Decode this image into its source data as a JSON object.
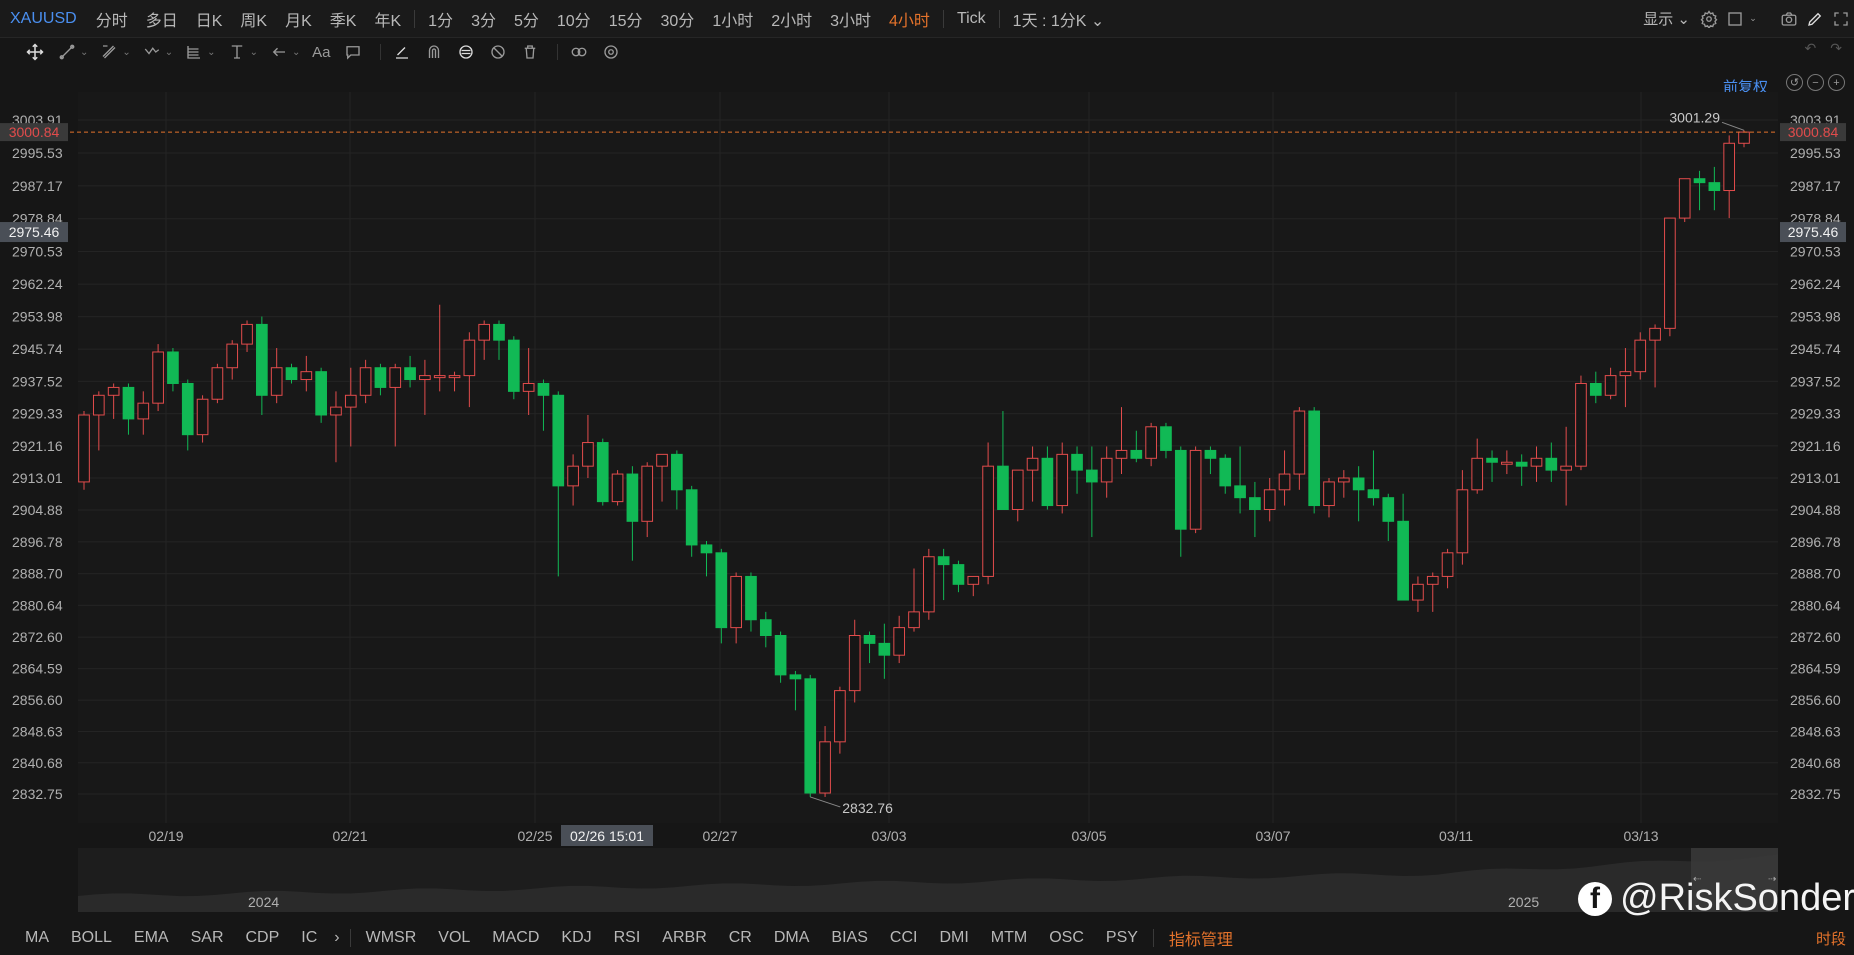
{
  "topbar": {
    "symbol": "XAUUSD",
    "timeframes": [
      "分时",
      "多日",
      "日K",
      "周K",
      "月K",
      "季K",
      "年K",
      "1分",
      "3分",
      "5分",
      "10分",
      "15分",
      "30分",
      "1小时",
      "2小时",
      "3小时",
      "4小时",
      "Tick"
    ],
    "active_timeframe": "4小时",
    "period_select": "1天 : 1分K",
    "display_label": "显示"
  },
  "adjust_label": "前复权",
  "bottombar": {
    "indicators_a": [
      "MA",
      "BOLL",
      "EMA",
      "SAR",
      "CDP",
      "IC"
    ],
    "indicators_b": [
      "WMSR",
      "VOL",
      "MACD",
      "KDJ",
      "RSI",
      "ARBR",
      "CR",
      "DMA",
      "BIAS",
      "CCI",
      "DMI",
      "MTM",
      "OSC",
      "PSY"
    ],
    "manage_label": "指标管理",
    "right_label": "时段"
  },
  "watermark": "@RiskSonder",
  "navigator": {
    "year_left": "2024",
    "year_right": "2025"
  },
  "colors": {
    "up": "#e24c4c",
    "down": "#11b955",
    "accent": "#e3722b",
    "link": "#4a8ff0"
  },
  "chart_data": {
    "type": "candlestick",
    "y_ticks": [
      "3003.91",
      "2995.53",
      "2987.17",
      "2978.84",
      "2970.53",
      "2962.24",
      "2953.98",
      "2945.74",
      "2937.52",
      "2929.33",
      "2921.16",
      "2913.01",
      "2904.88",
      "2896.78",
      "2888.70",
      "2880.64",
      "2872.60",
      "2864.59",
      "2856.60",
      "2848.63",
      "2840.68",
      "2832.75"
    ],
    "x_labels": [
      "02/19",
      "02/21",
      "02/25",
      "02/27",
      "03/03",
      "03/05",
      "03/07",
      "03/11",
      "03/13"
    ],
    "crosshair_x_label": "02/26 15:01",
    "current_price": "3000.84",
    "crosshair_price": "2975.46",
    "max_label": "3001.29",
    "min_label": "2832.76",
    "ohlc": [
      [
        2912,
        2930,
        2910,
        2929
      ],
      [
        2929,
        2935,
        2920,
        2934
      ],
      [
        2934,
        2937,
        2928,
        2936
      ],
      [
        2936,
        2937,
        2924,
        2928
      ],
      [
        2928,
        2935,
        2924,
        2932
      ],
      [
        2932,
        2947,
        2930,
        2945
      ],
      [
        2945,
        2946,
        2935,
        2937
      ],
      [
        2937,
        2938,
        2920,
        2924
      ],
      [
        2924,
        2934,
        2922,
        2933
      ],
      [
        2933,
        2942,
        2932,
        2941
      ],
      [
        2941,
        2948,
        2938,
        2947
      ],
      [
        2947,
        2953,
        2945,
        2952
      ],
      [
        2952,
        2954,
        2929,
        2934
      ],
      [
        2934,
        2946,
        2932,
        2941
      ],
      [
        2941,
        2942,
        2937,
        2938
      ],
      [
        2938,
        2944,
        2935,
        2940
      ],
      [
        2940,
        2941,
        2927,
        2929
      ],
      [
        2929,
        2935,
        2917,
        2931
      ],
      [
        2931,
        2941,
        2921,
        2934
      ],
      [
        2934,
        2943,
        2932,
        2941
      ],
      [
        2941,
        2942,
        2934,
        2936
      ],
      [
        2936,
        2942,
        2921,
        2941
      ],
      [
        2941,
        2944,
        2936,
        2938
      ],
      [
        2938,
        2943,
        2929,
        2939
      ],
      [
        2939,
        2957,
        2935,
        2939
      ],
      [
        2939,
        2940,
        2935,
        2939
      ],
      [
        2939,
        2950,
        2931,
        2948
      ],
      [
        2948,
        2953,
        2943,
        2952
      ],
      [
        2952,
        2953,
        2943,
        2948
      ],
      [
        2948,
        2949,
        2933,
        2935
      ],
      [
        2935,
        2946,
        2929,
        2937
      ],
      [
        2937,
        2938,
        2925,
        2934
      ],
      [
        2934,
        2935,
        2888,
        2911
      ],
      [
        2911,
        2919,
        2906,
        2916
      ],
      [
        2916,
        2929,
        2913,
        2922
      ],
      [
        2922,
        2923,
        2906,
        2907
      ],
      [
        2907,
        2915,
        2906,
        2914
      ],
      [
        2914,
        2916,
        2892,
        2902
      ],
      [
        2902,
        2917,
        2898,
        2916
      ],
      [
        2916,
        2919,
        2907,
        2919
      ],
      [
        2919,
        2920,
        2905,
        2910
      ],
      [
        2910,
        2911,
        2893,
        2896
      ],
      [
        2896,
        2897,
        2888,
        2894
      ],
      [
        2894,
        2895,
        2871,
        2875
      ],
      [
        2875,
        2889,
        2871,
        2888
      ],
      [
        2888,
        2889,
        2874,
        2877
      ],
      [
        2877,
        2879,
        2870,
        2873
      ],
      [
        2873,
        2874,
        2861,
        2863
      ],
      [
        2863,
        2864,
        2854,
        2862
      ],
      [
        2862,
        2863,
        2832,
        2833
      ],
      [
        2833,
        2850,
        2832,
        2846
      ],
      [
        2846,
        2860,
        2843,
        2859
      ],
      [
        2859,
        2877,
        2856,
        2873
      ],
      [
        2873,
        2874,
        2866,
        2871
      ],
      [
        2871,
        2876,
        2862,
        2868
      ],
      [
        2868,
        2878,
        2866,
        2875
      ],
      [
        2875,
        2890,
        2874,
        2879
      ],
      [
        2879,
        2895,
        2877,
        2893
      ],
      [
        2893,
        2895,
        2882,
        2891
      ],
      [
        2891,
        2892,
        2884,
        2886
      ],
      [
        2886,
        2888,
        2883,
        2888
      ],
      [
        2888,
        2922,
        2886,
        2916
      ],
      [
        2916,
        2930,
        2906,
        2905
      ],
      [
        2905,
        2913,
        2902,
        2915
      ],
      [
        2915,
        2921,
        2907,
        2918
      ],
      [
        2918,
        2921,
        2905,
        2906
      ],
      [
        2906,
        2922,
        2904,
        2919
      ],
      [
        2919,
        2921,
        2909,
        2915
      ],
      [
        2915,
        2921,
        2898,
        2912
      ],
      [
        2912,
        2921,
        2908,
        2918
      ],
      [
        2918,
        2931,
        2914,
        2920
      ],
      [
        2920,
        2925,
        2917,
        2918
      ],
      [
        2918,
        2927,
        2916,
        2926
      ],
      [
        2926,
        2927,
        2918,
        2920
      ],
      [
        2920,
        2921,
        2893,
        2900
      ],
      [
        2900,
        2921,
        2899,
        2920
      ],
      [
        2920,
        2921,
        2914,
        2918
      ],
      [
        2918,
        2919,
        2909,
        2911
      ],
      [
        2911,
        2921,
        2904,
        2908
      ],
      [
        2908,
        2912,
        2898,
        2905
      ],
      [
        2905,
        2913,
        2902,
        2910
      ],
      [
        2910,
        2920,
        2906,
        2914
      ],
      [
        2914,
        2931,
        2910,
        2930
      ],
      [
        2930,
        2931,
        2904,
        2906
      ],
      [
        2906,
        2913,
        2903,
        2912
      ],
      [
        2912,
        2915,
        2908,
        2913
      ],
      [
        2913,
        2916,
        2902,
        2910
      ],
      [
        2910,
        2920,
        2906,
        2908
      ],
      [
        2908,
        2909,
        2897,
        2902
      ],
      [
        2902,
        2909,
        2886,
        2882
      ],
      [
        2882,
        2888,
        2879,
        2886
      ],
      [
        2886,
        2889,
        2879,
        2888
      ],
      [
        2888,
        2895,
        2885,
        2894
      ],
      [
        2894,
        2915,
        2891,
        2910
      ],
      [
        2910,
        2923,
        2909,
        2918
      ],
      [
        2918,
        2920,
        2912,
        2917
      ],
      [
        2917,
        2920,
        2914,
        2917
      ],
      [
        2917,
        2919,
        2911,
        2916
      ],
      [
        2916,
        2921,
        2912,
        2918
      ],
      [
        2918,
        2922,
        2912,
        2915
      ],
      [
        2915,
        2926,
        2906,
        2916
      ],
      [
        2916,
        2939,
        2915,
        2937
      ],
      [
        2937,
        2940,
        2932,
        2934
      ],
      [
        2934,
        2941,
        2933,
        2939
      ],
      [
        2939,
        2946,
        2931,
        2940
      ],
      [
        2940,
        2950,
        2938,
        2948
      ],
      [
        2948,
        2952,
        2936,
        2951
      ],
      [
        2951,
        2979,
        2949,
        2979
      ],
      [
        2979,
        2989,
        2978,
        2989
      ],
      [
        2989,
        2991,
        2981,
        2988
      ],
      [
        2988,
        2992,
        2981,
        2986
      ],
      [
        2986,
        3000,
        2979,
        2998
      ],
      [
        2998,
        3001.29,
        2997,
        3000.84
      ]
    ]
  }
}
